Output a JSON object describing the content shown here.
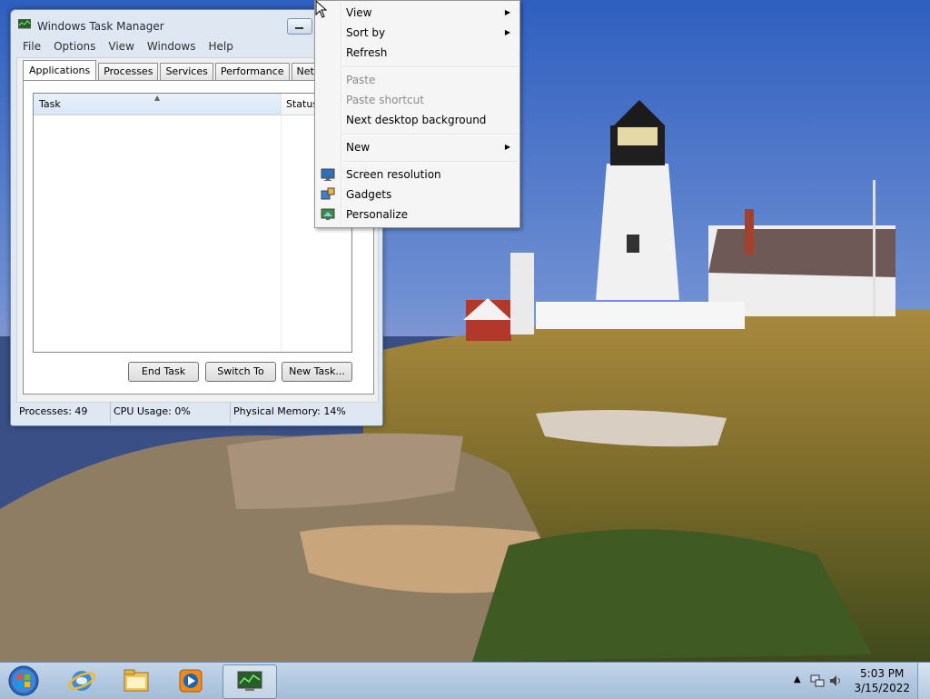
{
  "task_manager": {
    "title": "Windows Task Manager",
    "menu": [
      "File",
      "Options",
      "View",
      "Windows",
      "Help"
    ],
    "tabs": [
      "Applications",
      "Processes",
      "Services",
      "Performance",
      "Networking"
    ],
    "active_tab": "Applications",
    "columns": {
      "task": "Task",
      "status": "Status"
    },
    "buttons": {
      "end_task": "End Task",
      "switch_to": "Switch To",
      "new_task": "New Task..."
    },
    "status": {
      "processes": "Processes: 49",
      "cpu": "CPU Usage: 0%",
      "memory": "Physical Memory: 14%"
    }
  },
  "context_menu": {
    "items": {
      "view": "View",
      "sort_by": "Sort by",
      "refresh": "Refresh",
      "paste": "Paste",
      "paste_shortcut": "Paste shortcut",
      "next_bg": "Next desktop background",
      "new": "New",
      "screen_resolution": "Screen resolution",
      "gadgets": "Gadgets",
      "personalize": "Personalize"
    },
    "disabled": [
      "Paste",
      "Paste shortcut"
    ]
  },
  "taskbar": {
    "pinned_icons": [
      "start-orb-icon",
      "internet-explorer-icon",
      "file-explorer-icon",
      "media-player-icon",
      "task-manager-icon"
    ],
    "clock": {
      "time": "5:03 PM",
      "date": "3/15/2022"
    },
    "tray_icons": [
      "show-hidden-icons-icon",
      "network-icon",
      "volume-icon"
    ]
  },
  "colors": {
    "taskbar": "#a3bcd7",
    "window_frame": "#dfe8f2",
    "sky": "#3a6fc4"
  }
}
